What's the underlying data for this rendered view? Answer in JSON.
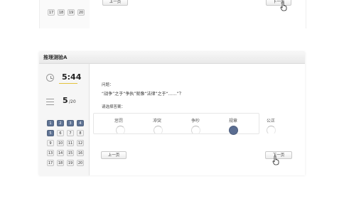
{
  "top": {
    "question_numbers": [
      "17",
      "18",
      "19",
      "20"
    ],
    "prev_label": "上一页",
    "next_label": "下一页"
  },
  "panel": {
    "title": "推理测验A",
    "timer": "5:44",
    "question_current": "5",
    "question_total": "/20",
    "question_numbers": [
      "1",
      "2",
      "3",
      "4",
      "5",
      "6",
      "7",
      "8",
      "9",
      "10",
      "11",
      "12",
      "13",
      "14",
      "15",
      "16",
      "17",
      "18",
      "19",
      "20"
    ],
    "answered_numbers": [
      "1",
      "2",
      "3",
      "4",
      "5"
    ],
    "question_prefix": "问题：",
    "question_text": "“战争”之于“争执”就像“法律”之于“……”？",
    "choose_prompt": "请选择答案：",
    "options": [
      "惩罚",
      "冲突",
      "争吵",
      "规章",
      "公正"
    ],
    "selected_option": "规章",
    "prev_label": "上一页",
    "next_label": "下一页"
  },
  "colors": {
    "selected": "#5a6d91",
    "timer_underline": "#e3c33c"
  },
  "icons": [
    "clock-icon",
    "question-list-icon",
    "hand-cursor-icon"
  ]
}
